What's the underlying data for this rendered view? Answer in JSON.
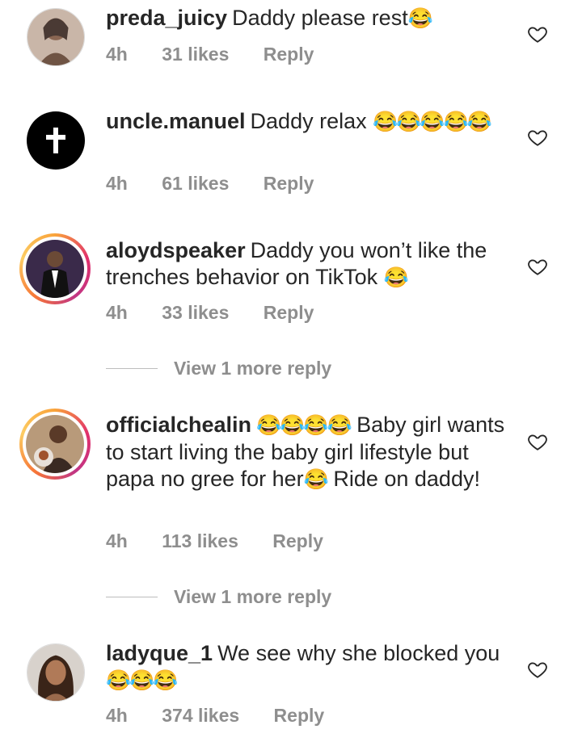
{
  "comments": [
    {
      "username": "preda_juicy",
      "text": "Daddy please rest",
      "emoji": "😂",
      "time": "4h",
      "likes": "31 likes",
      "reply": "Reply"
    },
    {
      "username": "uncle.manuel",
      "text": "Daddy relax ",
      "emoji": "😂😂😂😂😂",
      "time": "4h",
      "likes": "61 likes",
      "reply": "Reply"
    },
    {
      "username": "aloydspeaker",
      "text": "Daddy you won’t like the trenches behavior on TikTok ",
      "emoji": "😂",
      "time": "4h",
      "likes": "33 likes",
      "reply": "Reply",
      "view_more": "View 1 more reply"
    },
    {
      "username": "officialchealin",
      "emoji_lead": "😂😂😂😂",
      "text": " Baby girl wants to start living the baby girl lifestyle but papa no gree for her",
      "emoji": "😂",
      "text_tail": " Ride on daddy!",
      "time": "4h",
      "likes": "113 likes",
      "reply": "Reply",
      "view_more": "View 1 more reply"
    },
    {
      "username": "ladyque_1",
      "text": "We see why she blocked you ",
      "emoji": "😂😂😂",
      "time": "4h",
      "likes": "374 likes",
      "reply": "Reply"
    }
  ],
  "icons": {
    "like": "heart-outline-icon",
    "cross": "cross-icon"
  },
  "colors": {
    "meta": "#8e8e8e",
    "text": "#262626",
    "ring": "#e1306c"
  }
}
